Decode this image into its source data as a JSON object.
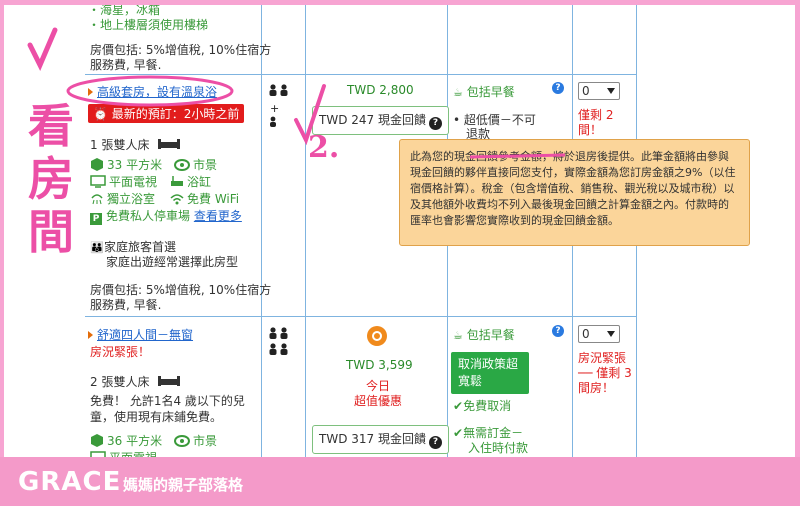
{
  "top_row": {
    "bullet_1": "・海星，冰箱",
    "bullet_2": "・地上樓層須使用樓梯",
    "price_includes": "房價包括: 5%增值稅, 10%住宿方",
    "price_includes_2": "服務費, 早餐."
  },
  "room_1": {
    "name": "高級套房，設有溫泉浴",
    "badge": "最新的預訂：2小時之前",
    "bed": "1 張雙人床",
    "size": "33 平方米",
    "view": "市景",
    "tv": "平面電視",
    "bath": "浴缸",
    "private_bath": "獨立浴室",
    "wifi": "免費 WiFi",
    "parking": "免費私人停車場",
    "more_link": "查看更多",
    "family_title": "家庭旅客首選",
    "family_desc": "家庭出遊經常選擇此房型",
    "price_includes": "房價包括: 5%增值稅, 10%住宿方",
    "price_includes_2": "服務費, 早餐.",
    "price": "TWD 2,800",
    "cash_back": "TWD 247 現金回饋",
    "breakfast": "包括早餐",
    "cond_1": "超低價－不可",
    "cond_2": "退款",
    "qty": "0",
    "left": "僅剩 2",
    "left_2": "間！"
  },
  "room_2": {
    "name": "舒適四人間－無窗",
    "status": "房況緊張！",
    "bed": "2 張雙人床",
    "kid_1": "免費！ 允許1名4 歲以下的兒",
    "kid_2": "童，使用現有床鋪免費。",
    "size": "36 平方米",
    "view": "市景",
    "tv": "平面電視",
    "price": "TWD 3,599",
    "deal_1": "今日",
    "deal_2": "超值優惠",
    "cash_back": "TWD 317 現金回饋",
    "breakfast": "包括早餐",
    "cancel_btn": "取消政策超寬鬆",
    "free_cancel": "免費取消",
    "no_prepay_1": "無需訂金－",
    "no_prepay_2": "入住時付款",
    "qty": "0",
    "status_right_1": "房況緊張",
    "status_right_2": "── 僅剩 3",
    "status_right_3": "間房！"
  },
  "tooltip": {
    "text": "此為您的現金回饋參考金額，將於退房後提供。此筆金額將由參與現金回饋的夥伴直接同您支付，實際金額為您訂房金額之9%（以住宿價格計算）。稅金（包含增值稅、銷售稅、觀光稅以及城市稅）以及其他額外收費均不列入最後現金回饋之計算金額之內。付款時的匯率也會影響您實際收到的現金回饋金額。"
  },
  "annotations": {
    "check": "√",
    "vertical_text": "看房間",
    "number": "2."
  },
  "banner": {
    "brand": "GRACE",
    "subtitle": "媽媽的親子部落格"
  },
  "colors": {
    "pink": "#f49ac9",
    "grid": "#7fb4e0",
    "green": "#2aa845",
    "red": "#e02020",
    "tooltip_bg": "#fbd59a"
  }
}
